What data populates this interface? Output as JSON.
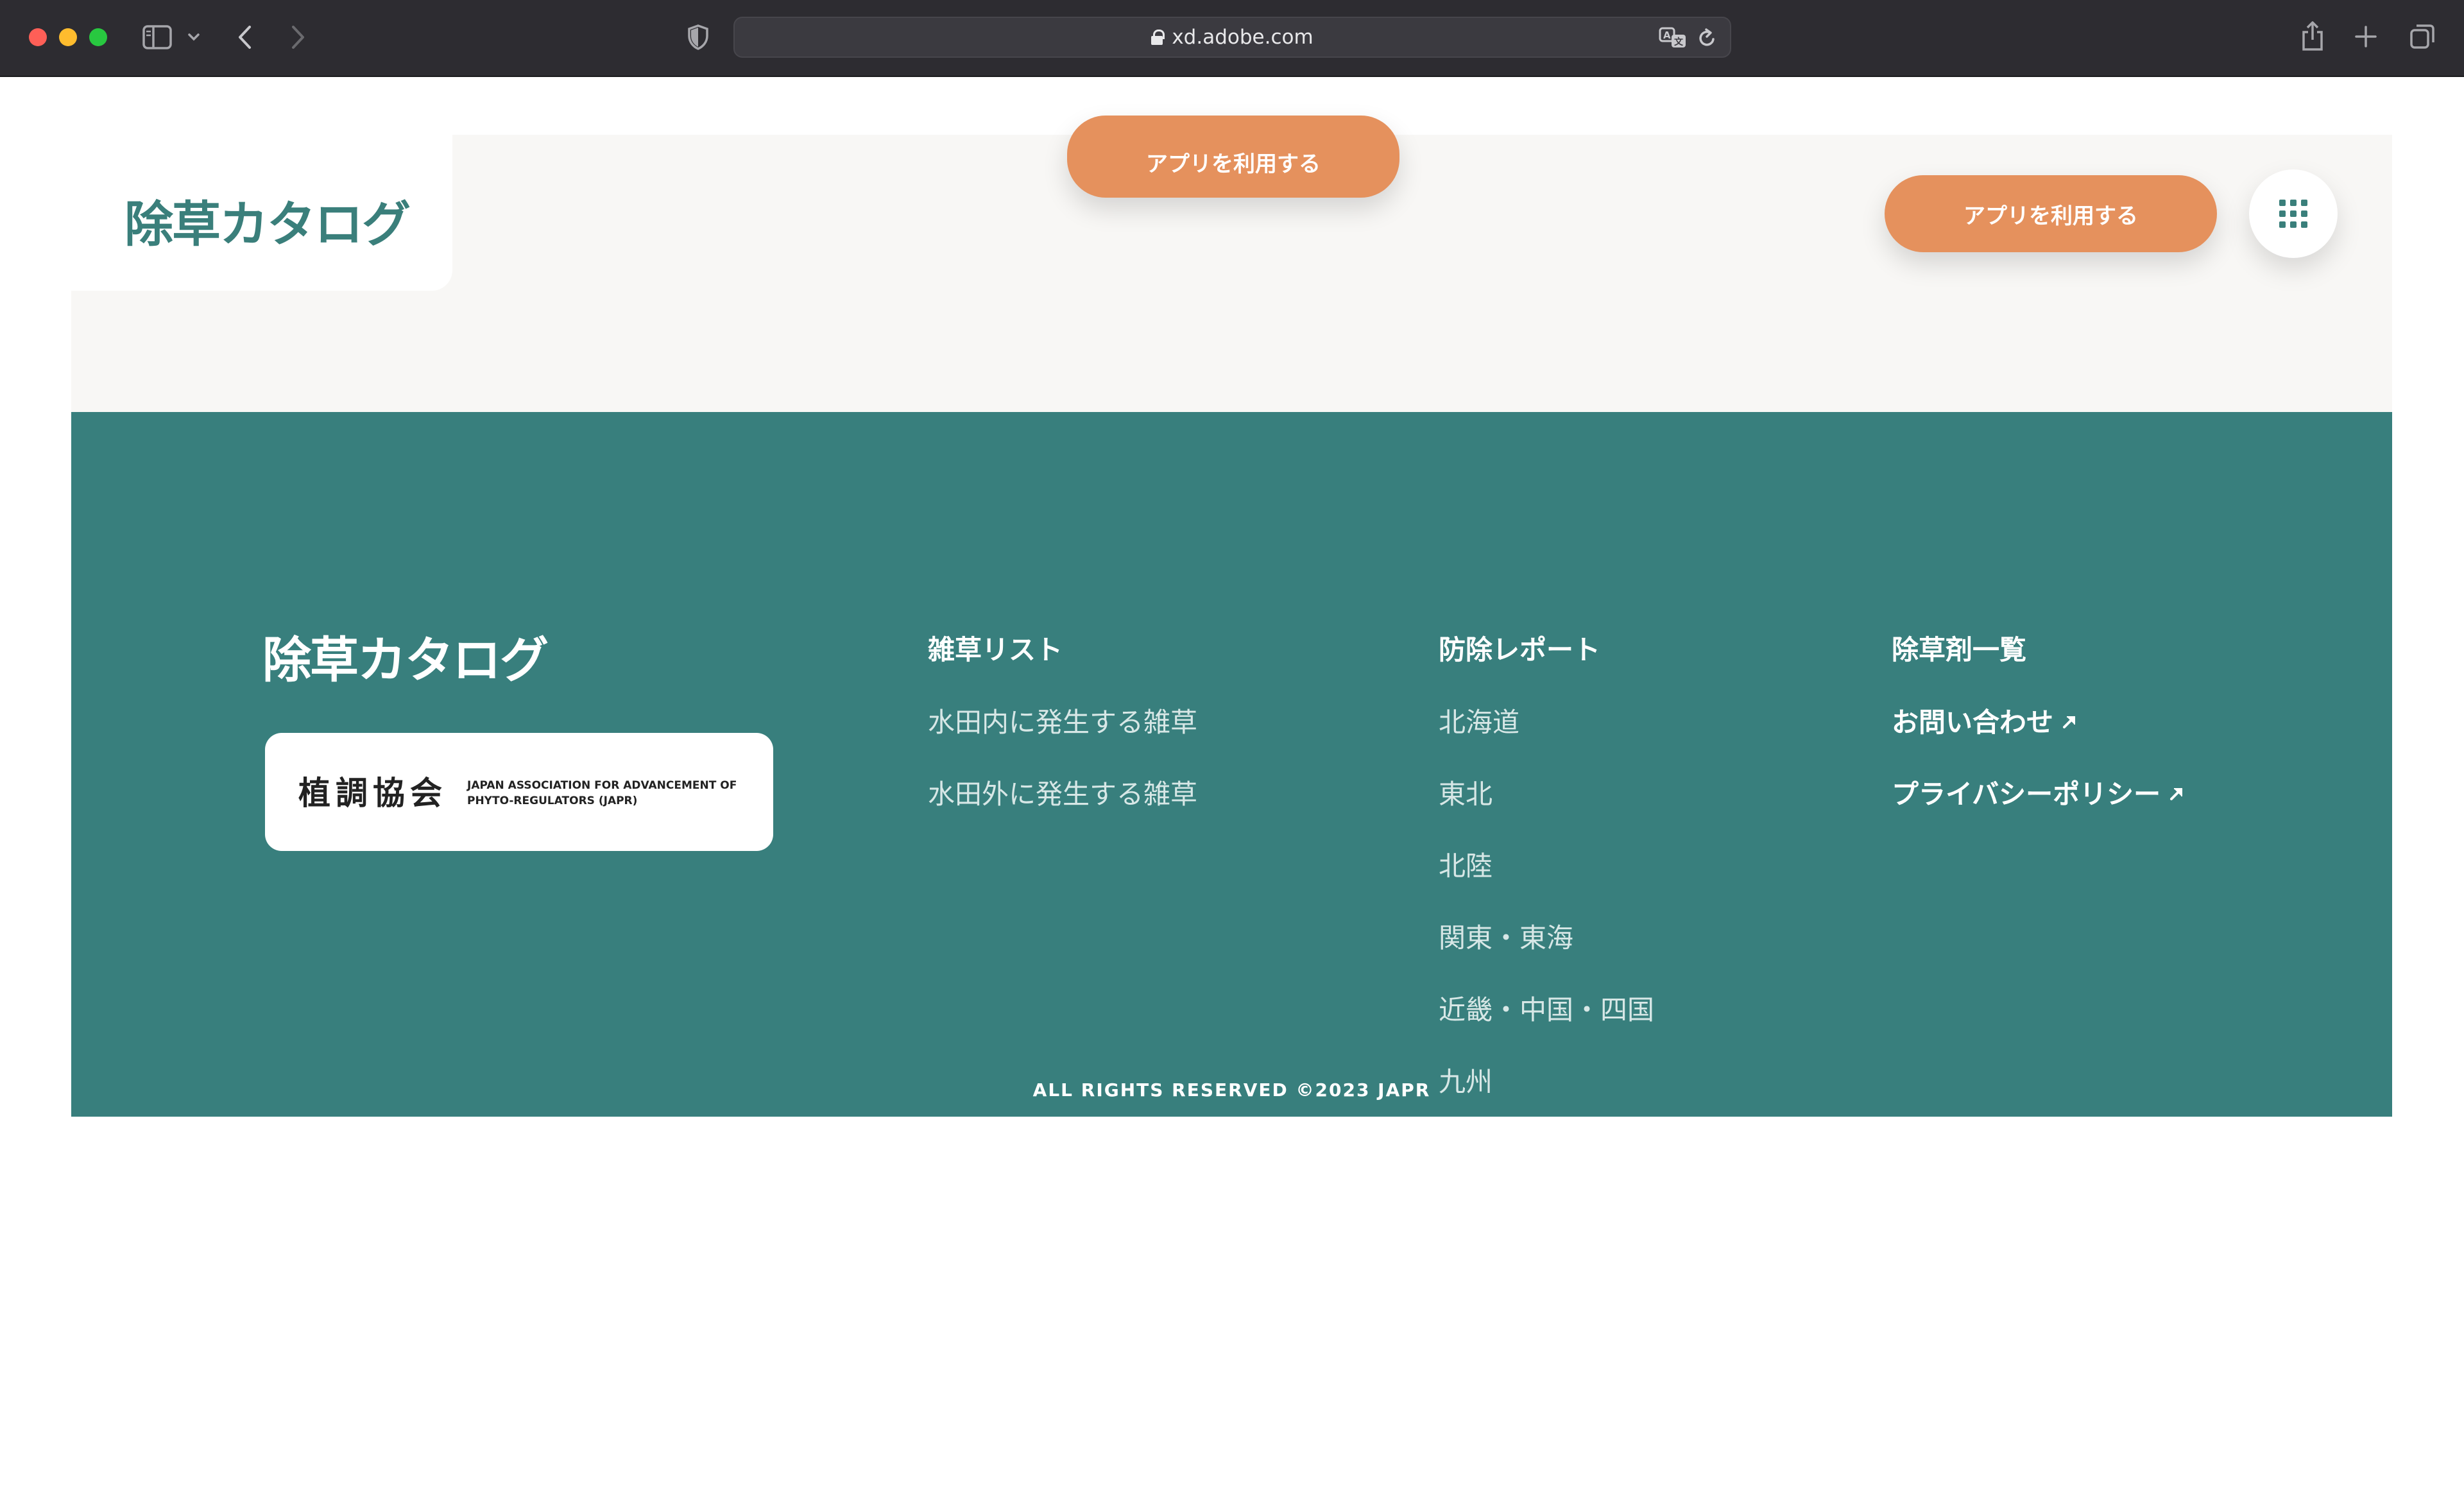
{
  "browser": {
    "url": "xd.adobe.com"
  },
  "header": {
    "logo": "除草カタログ",
    "cta_center": "アプリを利用する",
    "cta_right": "アプリを利用する"
  },
  "footer": {
    "logo": "除草カタログ",
    "partner": {
      "kanji": "植調協会",
      "english_line1": "JAPAN ASSOCIATION FOR ADVANCEMENT OF",
      "english_line2": "PHYTO-REGULATORS (JAPR)"
    },
    "weeds": {
      "heading": "雑草リスト",
      "links": [
        "水田内に発生する雑草",
        "水田外に発生する雑草"
      ]
    },
    "reports": {
      "heading": "防除レポート",
      "links": [
        "北海道",
        "東北",
        "北陸",
        "関東・東海",
        "近畿・中国・四国",
        "九州"
      ]
    },
    "herbicides": {
      "heading": "除草剤一覧",
      "contact": "お問い合わせ",
      "privacy": "プライバシーポリシー"
    },
    "copyright": "ALL RIGHTS RESERVED ©2023 JAPR"
  },
  "colors": {
    "teal": "#387f7d",
    "orange": "#e5915d",
    "hero_bg": "#f8f7f5"
  },
  "icons": [
    "sidebar-icon",
    "chevron-down-icon",
    "back-icon",
    "forward-icon",
    "shield-icon",
    "lock-icon",
    "translate-icon",
    "reload-icon",
    "share-icon",
    "plus-icon",
    "tabs-icon",
    "grid-menu-icon",
    "external-link-icon"
  ]
}
